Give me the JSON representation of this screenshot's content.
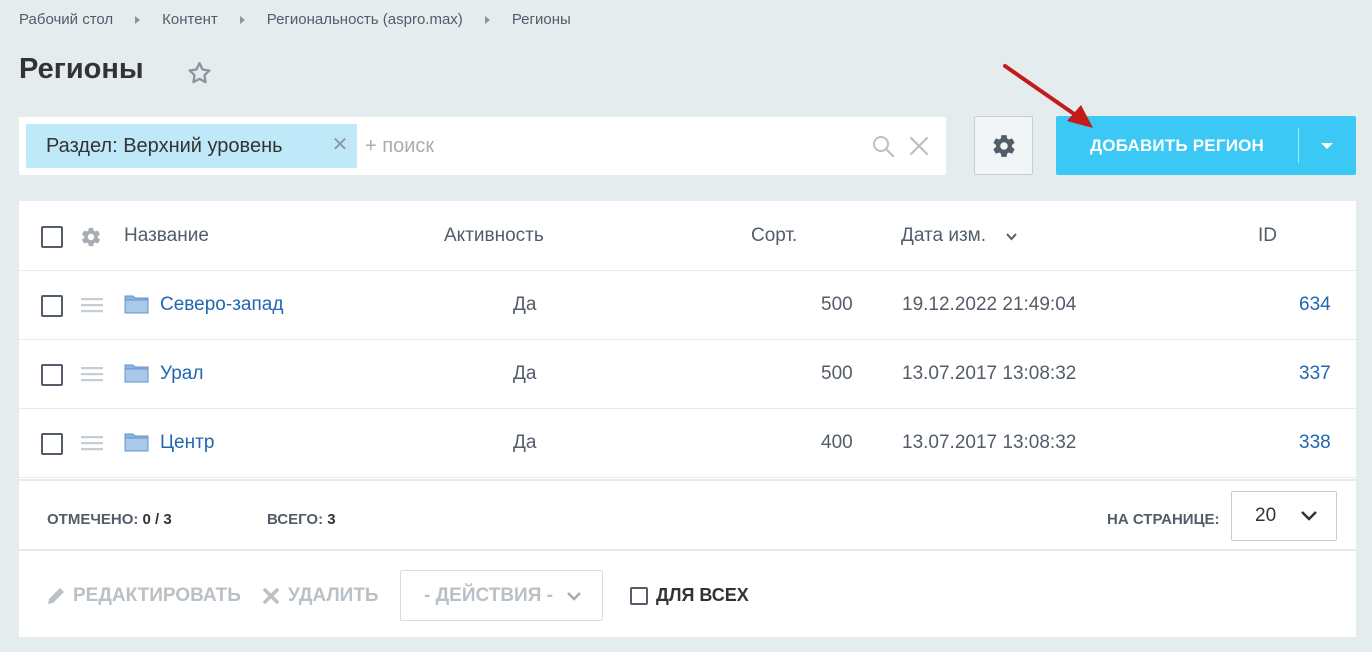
{
  "breadcrumb": [
    "Рабочий стол",
    "Контент",
    "Региональность (aspro.max)",
    "Регионы"
  ],
  "page": {
    "title": "Регионы"
  },
  "filter": {
    "tag_label": "Раздел: Верхний уровень",
    "search_placeholder": "+ поиск"
  },
  "toolbar": {
    "add_label": "ДОБАВИТЬ РЕГИОН"
  },
  "colors": {
    "accent": "#3bc8f5",
    "link": "#2067b0",
    "tag": "#bfe9f9",
    "arrow": "#c41a1a"
  },
  "grid": {
    "columns": {
      "name": "Название",
      "active": "Активность",
      "sort": "Сорт.",
      "date": "Дата изм.",
      "id": "ID"
    },
    "rows": [
      {
        "name": "Северо-запад",
        "active": "Да",
        "sort": "500",
        "date": "19.12.2022 21:49:04",
        "id": "634"
      },
      {
        "name": "Урал",
        "active": "Да",
        "sort": "500",
        "date": "13.07.2017 13:08:32",
        "id": "337"
      },
      {
        "name": "Центр",
        "active": "Да",
        "sort": "400",
        "date": "13.07.2017 13:08:32",
        "id": "338"
      }
    ]
  },
  "footer": {
    "selected_label": "ОТМЕЧЕНО:",
    "selected_value": "0 / 3",
    "total_label": "ВСЕГО:",
    "total_value": "3",
    "perpage_label": "НА СТРАНИЦЕ:",
    "perpage_value": "20"
  },
  "actions": {
    "edit_label": "РЕДАКТИРОВАТЬ",
    "delete_label": "УДАЛИТЬ",
    "select_label": "- ДЕЙСТВИЯ -",
    "forall_label": "ДЛЯ ВСЕХ"
  }
}
